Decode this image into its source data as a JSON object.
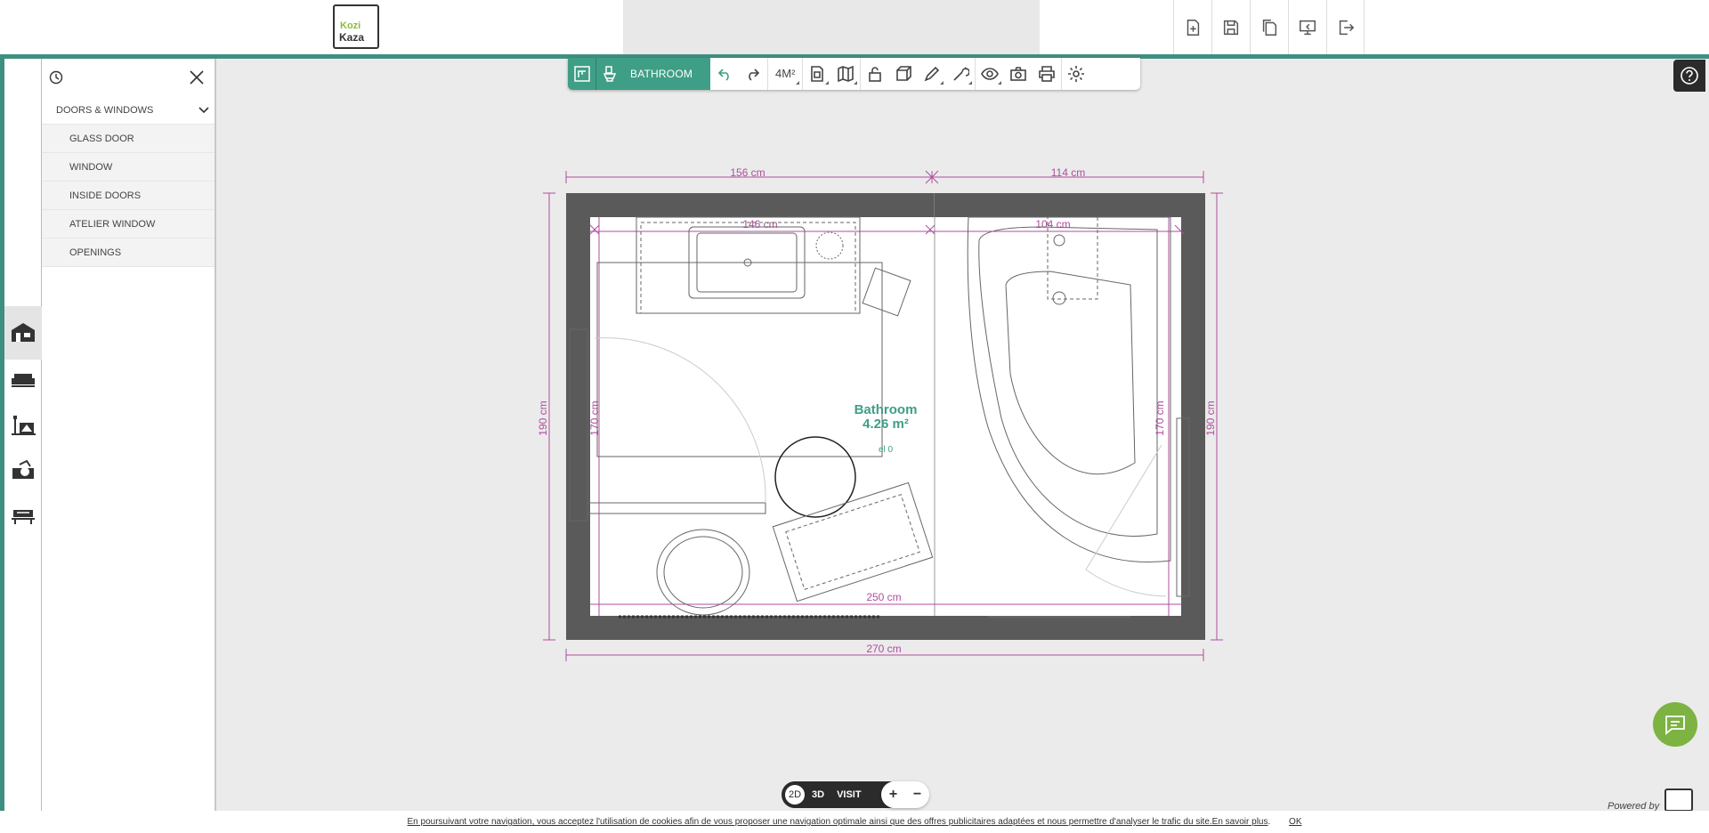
{
  "app": {
    "logo_line1": "Kozi",
    "logo_line2": "Kaza",
    "accent_color": "#3f9e86"
  },
  "top_actions": [
    {
      "icon": "new-project-icon"
    },
    {
      "icon": "save-icon"
    },
    {
      "icon": "duplicate-icon"
    },
    {
      "icon": "present-icon"
    },
    {
      "icon": "logout-icon"
    }
  ],
  "left_tools": [
    {
      "icon": "house-icon",
      "active": true
    },
    {
      "icon": "sofa-icon"
    },
    {
      "icon": "interior-icon"
    },
    {
      "icon": "paint-icon"
    },
    {
      "icon": "furniture-catalog-icon"
    }
  ],
  "catalog": {
    "section_title": "DOORS & WINDOWS",
    "items": [
      "GLASS DOOR",
      "WINDOW",
      "INSIDE DOORS",
      "ATELIER WINDOW",
      "OPENINGS"
    ]
  },
  "toolbar": {
    "room_name": "BATHROOM",
    "area_toggle": "4M²"
  },
  "plan": {
    "room_label": "Bathroom",
    "room_area": "4.26 m²",
    "level_label": "el 0",
    "dim_top_left": "156 cm",
    "dim_top_right": "114 cm",
    "dim_bottom": "270 cm",
    "dim_inner_bottom": "250 cm",
    "dim_left": "190 cm",
    "dim_right": "190 cm",
    "dim_inner_left": "170 cm",
    "dim_inner_right": "170 cm",
    "dim_vanity": "146 cm",
    "dim_bath_top": "104 cm"
  },
  "view": {
    "mode_2d": "2D",
    "mode_3d": "3D",
    "mode_visit": "VISIT",
    "zoom_in": "+",
    "zoom_out": "−"
  },
  "footer": {
    "powered_by": "Powered by",
    "cookie_text": "En poursuivant votre navigation, vous acceptez l'utilisation de cookies afin de vous proposer une navigation optimale ainsi que des offres publicitaires adaptées et nous permettre d'analyser le trafic du site.",
    "cookie_link": "En savoir plus",
    "cookie_ok": "OK"
  }
}
